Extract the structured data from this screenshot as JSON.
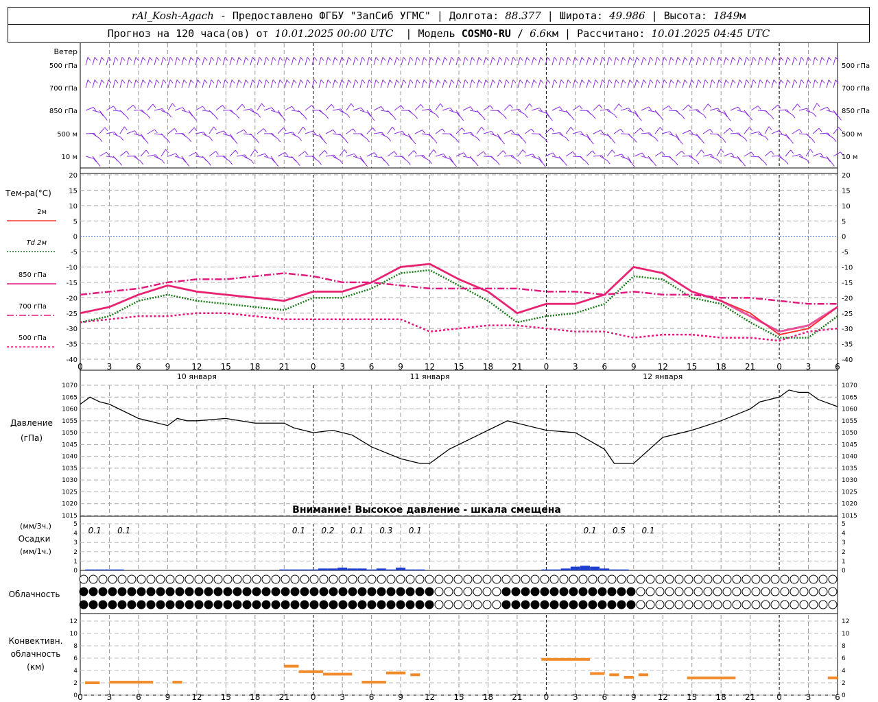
{
  "header": {
    "station": "rAl_Kosh-Agach",
    "provider": "Предоставлено ФГБУ \"ЗапСиб УГМС\"",
    "lon_label": "Долгота:",
    "lon": "88.377",
    "lat_label": "Широта:",
    "lat": "49.986",
    "alt_label": "Высота:",
    "alt": "1849",
    "alt_unit": "м",
    "forecast_label": "Прогноз на 120 часа(ов) от",
    "forecast_start": "10.01.2025 00:00 UTC",
    "model_label": "Модель",
    "model": "COSMO-RU",
    "resolution": "6.6",
    "res_unit": "км",
    "computed_label": "Рассчитано:",
    "computed": "10.01.2025 04:45 UTC"
  },
  "wind_panel": {
    "title": "Ветер",
    "levels": [
      "500 гПа",
      "700 гПа",
      "850 гПа",
      "500 м",
      "10  м"
    ],
    "color": "#8a2be2"
  },
  "x_axis": {
    "hour_ticks": [
      "0",
      "3",
      "6",
      "9",
      "12",
      "15",
      "18",
      "21",
      "0",
      "3",
      "6",
      "9",
      "12",
      "15",
      "18",
      "21",
      "0",
      "3",
      "6",
      "9",
      "12",
      "15",
      "18",
      "21",
      "0",
      "3",
      "6"
    ],
    "days": [
      "10 января",
      "11 января",
      "12 января"
    ]
  },
  "temp_legend": {
    "title": "Тем-ра(°C)",
    "items": [
      {
        "label": "2м",
        "color": "#ff3333",
        "dash": "solid"
      },
      {
        "label": "Td  2м",
        "color": "#1a7a1a",
        "dash": "dotted"
      },
      {
        "label": "850 гПа",
        "color": "#e0197d",
        "dash": "solid"
      },
      {
        "label": "700 гПа",
        "color": "#e0197d",
        "dash": "dashdot"
      },
      {
        "label": "500 гПа",
        "color": "#e0197d",
        "dotted": true
      }
    ]
  },
  "pressure_panel": {
    "title": "Давление",
    "unit": "(гПа)",
    "warning": "Внимание! Высокое давление - шкала смещена"
  },
  "precip_panel": {
    "unit3": "(мм/3ч.)",
    "title": "Осадки",
    "unit1": "(мм/1ч.)",
    "labels": [
      "0.1",
      "0.1",
      "0.1",
      "0.2",
      "0.1",
      "0.3",
      "0.1",
      "0.1",
      "0.5",
      "0.1"
    ]
  },
  "cloud_panel": {
    "title": "Облачность"
  },
  "conv_panel": {
    "title1": "Конвективн.",
    "title2": "облачность",
    "unit": "(км)"
  },
  "chart_data": {
    "type": "line",
    "x_hours": [
      0,
      6,
      9,
      12,
      15,
      18,
      21,
      24,
      27,
      30,
      33,
      36,
      39,
      42,
      45,
      48,
      51,
      54,
      57,
      60,
      63,
      66,
      69,
      72,
      75,
      78
    ],
    "temperature": {
      "ylim": [
        -40,
        20
      ],
      "yticks": [
        20,
        15,
        10,
        5,
        0,
        -5,
        -10,
        -15,
        -20,
        -25,
        -30,
        -35,
        -40
      ],
      "series": [
        {
          "name": "2м",
          "x": [
            0,
            3,
            6,
            9,
            12,
            15,
            18,
            21,
            24,
            27,
            30,
            33,
            36,
            39,
            42,
            45,
            48,
            51,
            54,
            57,
            60,
            63,
            66,
            69,
            72,
            75,
            78
          ],
          "values": [
            -25,
            -23,
            -19,
            -16,
            -18,
            -19,
            -20,
            -21,
            -18,
            -18,
            -15,
            -10,
            -9,
            -14,
            -18,
            -25,
            -22,
            -22,
            -19,
            -10,
            -12,
            -18,
            -21,
            -25,
            -32,
            -30,
            -23
          ]
        },
        {
          "name": "Td 2м",
          "x": [
            0,
            3,
            6,
            9,
            12,
            15,
            18,
            21,
            24,
            27,
            30,
            33,
            36,
            39,
            42,
            45,
            48,
            51,
            54,
            57,
            60,
            63,
            66,
            69,
            72,
            75,
            78
          ],
          "values": [
            -28,
            -26,
            -21,
            -19,
            -21,
            -22,
            -23,
            -24,
            -20,
            -20,
            -17,
            -12,
            -11,
            -16,
            -21,
            -28,
            -26,
            -25,
            -22,
            -13,
            -14,
            -20,
            -22,
            -28,
            -33,
            -33,
            -26
          ]
        },
        {
          "name": "850 гПа",
          "x": [
            0,
            3,
            6,
            9,
            12,
            15,
            18,
            21,
            24,
            27,
            30,
            33,
            36,
            39,
            42,
            45,
            48,
            51,
            54,
            57,
            60,
            63,
            66,
            69,
            72,
            75,
            78
          ],
          "values": [
            -25,
            -23,
            -19,
            -16,
            -18,
            -19,
            -20,
            -21,
            -18,
            -18,
            -15,
            -10,
            -9,
            -14,
            -18,
            -25,
            -22,
            -22,
            -19,
            -10,
            -12,
            -18,
            -21,
            -26,
            -31,
            -29,
            -23
          ]
        },
        {
          "name": "700 гПа",
          "x": [
            0,
            3,
            6,
            9,
            12,
            15,
            18,
            21,
            24,
            27,
            30,
            33,
            36,
            39,
            42,
            45,
            48,
            51,
            54,
            57,
            60,
            63,
            66,
            69,
            72,
            75,
            78
          ],
          "values": [
            -19,
            -18,
            -17,
            -15,
            -14,
            -14,
            -13,
            -12,
            -13,
            -15,
            -15,
            -16,
            -17,
            -17,
            -17,
            -17,
            -18,
            -18,
            -19,
            -18,
            -19,
            -19,
            -20,
            -20,
            -21,
            -22,
            -22
          ]
        },
        {
          "name": "500 гПа",
          "x": [
            0,
            3,
            6,
            9,
            12,
            15,
            18,
            21,
            24,
            27,
            30,
            33,
            36,
            39,
            42,
            45,
            48,
            51,
            54,
            57,
            60,
            63,
            66,
            69,
            72,
            75,
            78
          ],
          "values": [
            -28,
            -27,
            -26,
            -26,
            -25,
            -25,
            -26,
            -27,
            -27,
            -27,
            -27,
            -27,
            -31,
            -30,
            -29,
            -29,
            -30,
            -31,
            -31,
            -33,
            -32,
            -32,
            -33,
            -33,
            -34,
            -31,
            -30
          ]
        }
      ]
    },
    "pressure": {
      "ylim": [
        1015,
        1070
      ],
      "yticks": [
        1070,
        1065,
        1060,
        1055,
        1050,
        1045,
        1040,
        1035,
        1030,
        1025,
        1020,
        1015
      ],
      "x": [
        0,
        1,
        2,
        3,
        6,
        9,
        10,
        11,
        12,
        15,
        18,
        21,
        22,
        24,
        26,
        28,
        30,
        33,
        35,
        36,
        38,
        42,
        44,
        45,
        48,
        51,
        54,
        55,
        56,
        57,
        60,
        63,
        66,
        69,
        70,
        72,
        73,
        74,
        75,
        76,
        78
      ],
      "values": [
        1062,
        1065,
        1063,
        1062,
        1056,
        1053,
        1056,
        1055,
        1055,
        1056,
        1054,
        1054,
        1052,
        1050,
        1051,
        1049,
        1044,
        1039,
        1037,
        1037,
        1043,
        1051,
        1055,
        1054,
        1051,
        1050,
        1043,
        1037,
        1037,
        1037,
        1048,
        1051,
        1055,
        1060,
        1063,
        1065,
        1068,
        1067,
        1067,
        1064,
        1061
      ]
    },
    "precipitation": {
      "ylim": [
        0,
        5
      ],
      "x": [
        1,
        2,
        3,
        4,
        21,
        22,
        23,
        24,
        25,
        26,
        27,
        28,
        29,
        30,
        31,
        32,
        33,
        34,
        35,
        48,
        49,
        50,
        51,
        52,
        53,
        54,
        55,
        56
      ],
      "values": [
        0.1,
        0.1,
        0.1,
        0.1,
        0.1,
        0.1,
        0.1,
        0.1,
        0.2,
        0.2,
        0.3,
        0.2,
        0.2,
        0.1,
        0.2,
        0.1,
        0.3,
        0.1,
        0.1,
        0.1,
        0.1,
        0.2,
        0.4,
        0.5,
        0.4,
        0.2,
        0.1,
        0.1
      ]
    },
    "convective": {
      "ylim": [
        0,
        13
      ],
      "yticks": [
        12,
        10,
        8,
        6,
        4,
        2,
        0
      ],
      "segments": [
        {
          "x0": 0.5,
          "x1": 2,
          "h": 2.0
        },
        {
          "x0": 3,
          "x1": 7.5,
          "h": 2.1
        },
        {
          "x0": 9.5,
          "x1": 10.5,
          "h": 2.1
        },
        {
          "x0": 21,
          "x1": 22.5,
          "h": 4.7
        },
        {
          "x0": 22.5,
          "x1": 25,
          "h": 3.8
        },
        {
          "x0": 25,
          "x1": 28,
          "h": 3.4
        },
        {
          "x0": 29,
          "x1": 31.5,
          "h": 2.1
        },
        {
          "x0": 31.5,
          "x1": 33.5,
          "h": 3.6
        },
        {
          "x0": 34,
          "x1": 35,
          "h": 3.3
        },
        {
          "x0": 47.5,
          "x1": 52.5,
          "h": 5.8
        },
        {
          "x0": 52.5,
          "x1": 54,
          "h": 3.5
        },
        {
          "x0": 54.5,
          "x1": 55.5,
          "h": 3.3
        },
        {
          "x0": 56,
          "x1": 57,
          "h": 2.9
        },
        {
          "x0": 57.5,
          "x1": 58.5,
          "h": 3.3
        },
        {
          "x0": 62.5,
          "x1": 67.5,
          "h": 2.8
        },
        {
          "x0": 77,
          "x1": 78,
          "h": 2.8
        }
      ]
    }
  }
}
